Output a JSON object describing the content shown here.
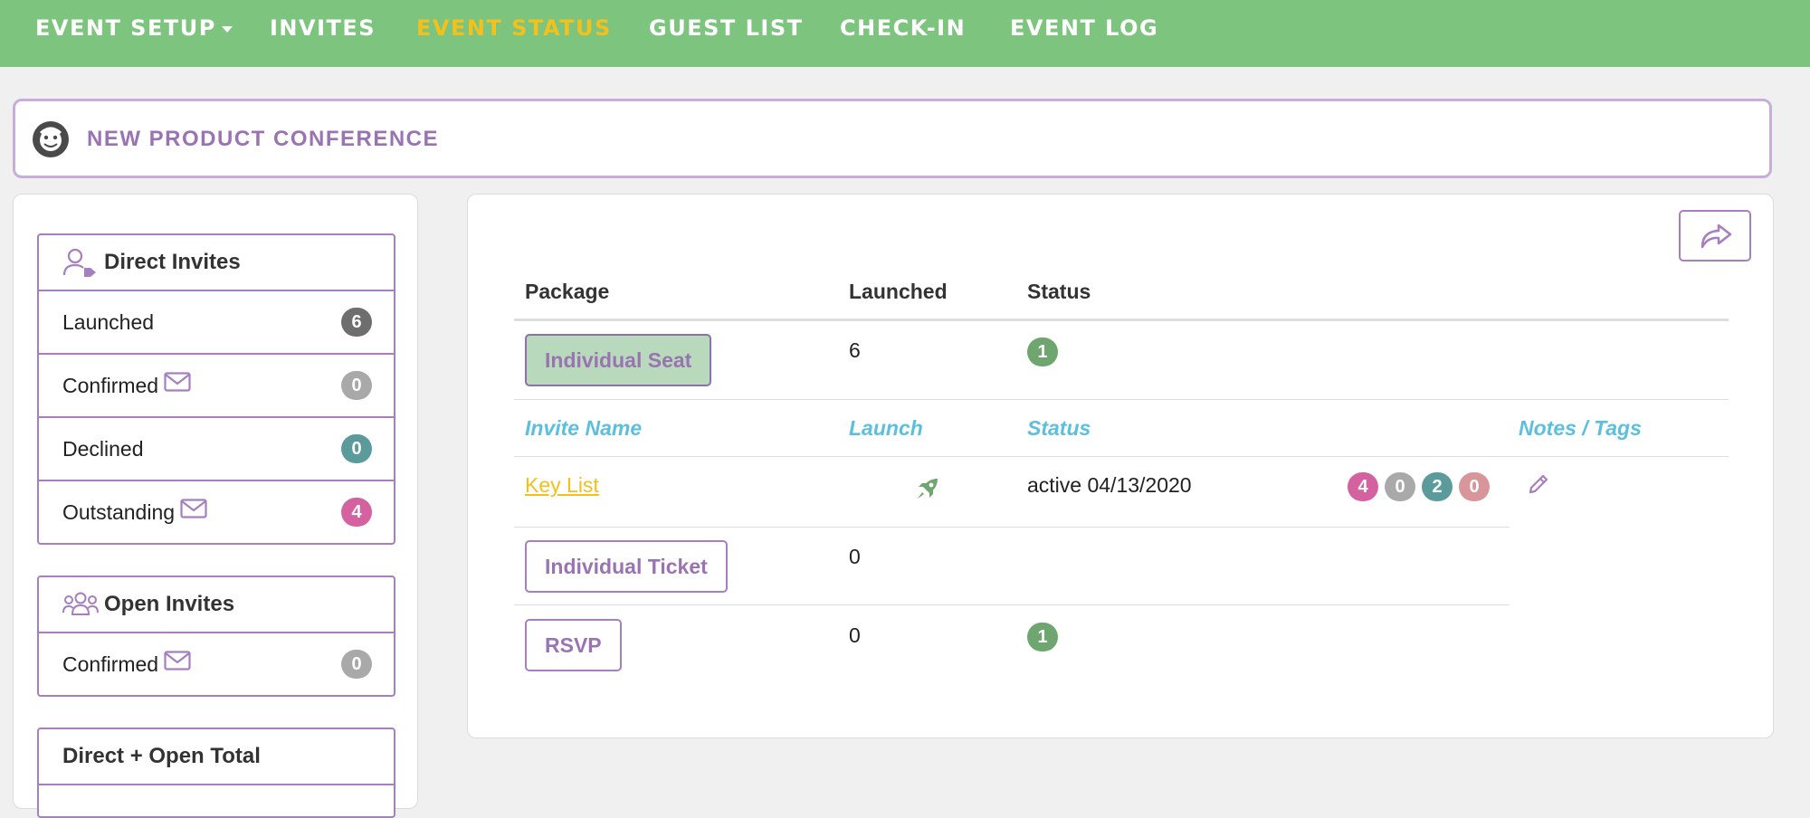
{
  "nav": {
    "items": [
      {
        "label": "EVENT SETUP"
      },
      {
        "label": "INVITES"
      },
      {
        "label": "EVENT STATUS"
      },
      {
        "label": "GUEST LIST"
      },
      {
        "label": "CHECK-IN"
      },
      {
        "label": "EVENT LOG"
      }
    ],
    "active": "EVENT STATUS"
  },
  "event": {
    "title": "NEW PRODUCT CONFERENCE"
  },
  "direct_invites": {
    "title": "Direct Invites",
    "rows": [
      {
        "label": "Launched",
        "count": "6",
        "color": "#6e6e6e"
      },
      {
        "label": "Confirmed",
        "count": "0",
        "color": "#a9a9a9"
      },
      {
        "label": "Declined",
        "count": "0",
        "color": "#5b9b9c"
      },
      {
        "label": "Outstanding",
        "count": "4",
        "color": "#d462a1"
      }
    ]
  },
  "open_invites": {
    "title": "Open Invites",
    "rows": [
      {
        "label": "Confirmed",
        "count": "0",
        "color": "#a9a9a9"
      }
    ]
  },
  "total": {
    "title": "Direct + Open Total"
  },
  "table": {
    "headers": {
      "package": "Package",
      "launched": "Launched",
      "status": "Status"
    },
    "sub_headers": {
      "invite_name": "Invite Name",
      "launch": "Launch",
      "status": "Status",
      "notes": "Notes / Tags"
    },
    "packages": [
      {
        "name": "Individual Seat",
        "launched": "6",
        "status_count": "1"
      },
      {
        "name": "Individual Ticket",
        "launched": "0"
      },
      {
        "name": "RSVP",
        "launched": "0",
        "status_count": "1"
      }
    ],
    "invite": {
      "name": "Key List",
      "status": "active 04/13/2020",
      "counts": [
        {
          "value": "4",
          "color": "#d462a1"
        },
        {
          "value": "0",
          "color": "#a9a9a9"
        },
        {
          "value": "2",
          "color": "#5b9b9c"
        },
        {
          "value": "0",
          "color": "#d9969a"
        }
      ]
    }
  },
  "icons": {
    "logo": "event-logo-icon",
    "direct": "user-tag-icon",
    "open": "users-icon",
    "envelope": "envelope-icon",
    "rocket": "rocket-icon",
    "pencil": "pencil-icon",
    "share": "share-icon"
  },
  "colors": {
    "nav_bg": "#7dc47f",
    "nav_active": "#f3c01c",
    "accent_purple": "#a57fc0",
    "status_green": "#6fa56f",
    "subheader_blue": "#5bc0de"
  }
}
